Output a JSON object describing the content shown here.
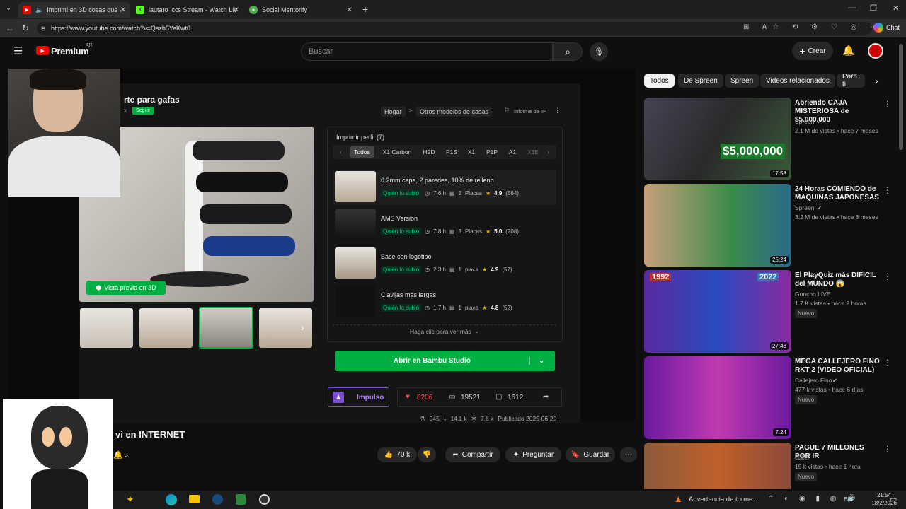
{
  "tabs": [
    {
      "label": "Imprimí en 3D cosas que vi en",
      "active": true
    },
    {
      "label": "lautaro_ccs Stream - Watch Live o"
    },
    {
      "label": "Social Mentorify"
    }
  ],
  "address": {
    "url": "https://www.youtube.com/watch?v=Qszb5YeKwt0",
    "chat_label": "Chat"
  },
  "youtube": {
    "brand": "Premium",
    "region": "AR",
    "search_placeholder": "Buscar",
    "create_label": "Crear"
  },
  "model": {
    "title_partial": "rte para gafas",
    "author_partial": "x",
    "follow_label": "Seguir",
    "breadcrumb": [
      "Hogar",
      ">",
      "Otros modelos de casas"
    ],
    "report_label": "Informe de IP",
    "preview3d_label": "Vista previa en 3D",
    "print_profile_header": "Imprimir perfil (7)",
    "printer_tabs": [
      "Todos",
      "X1 Carbon",
      "H2D",
      "P1S",
      "X1",
      "P1P",
      "A1",
      "X1E"
    ],
    "quien_label": "Quién lo subió",
    "profiles": [
      {
        "title": "0.2mm capa, 2 paredes, 10% de relleno",
        "time": "7.6 h",
        "plates": "2",
        "plates_label": "Placas",
        "rating": "4.9",
        "count": "(564)"
      },
      {
        "title": "AMS Version",
        "time": "7.8 h",
        "plates": "3",
        "plates_label": "Placas",
        "rating": "5.0",
        "count": "(208)"
      },
      {
        "title": "Base con logotipo",
        "time": "2.3 h",
        "plates": "1",
        "plates_label": "placa",
        "rating": "4.9",
        "count": "(57)"
      },
      {
        "title": "Clavijas más largas",
        "time": "1.7 h",
        "plates": "1",
        "plates_label": "placa",
        "rating": "4.8",
        "count": "(52)"
      }
    ],
    "more_label": "Haga clic para ver más",
    "open_label": "Abrir en Bambu Studio",
    "boost_label": "Impulso",
    "likes": "8206",
    "collections": "19521",
    "comments_count": "1612",
    "stats": {
      "prints": "945",
      "downloads": "14.1 k",
      "boosts": "7.8 k",
      "published": "Publicado 2025-06-29"
    }
  },
  "video": {
    "title_partial": "vi en INTERNET",
    "like_count": "70 k",
    "share_label": "Compartir",
    "ask_label": "Preguntar",
    "save_label": "Guardar"
  },
  "chips": [
    "Todos",
    "De Spreen",
    "Spreen",
    "Videos relacionados",
    "Para ti"
  ],
  "recommendations": [
    {
      "title": "Abriendo CAJA MISTERIOSA de $5.000.000",
      "channel": "Spreen",
      "meta": "2.1 M de vistas • hace 7 meses",
      "duration": "17:58",
      "thumb_text": "$5,000,000"
    },
    {
      "title": "24 Horas COMIENDO de MAQUINAS JAPONESAS",
      "channel": "Spreen",
      "meta": "3.2 M de vistas • hace 8 meses",
      "duration": "25:24"
    },
    {
      "title": "El PlayQuiz más DIFÍCIL del MUNDO 😱",
      "channel": "Goncho LIVE",
      "meta": "1.7 K vistas • hace 2 horas",
      "badge": "Nuevo",
      "duration": "27:43",
      "thumb_years": [
        "1992",
        "2022"
      ]
    },
    {
      "title": "MEGA CALLEJERO FINO RKT 2 (VIDEO OFICIAL)",
      "channel": "Callejero Fino",
      "meta": "477 k vistas • hace 6 días",
      "badge": "Nuevo",
      "duration": "7:24"
    },
    {
      "title": "PAGUE 7 MILLONES POR IR",
      "channel": "c0ker",
      "meta": "15 k vistas • hace 1 hora",
      "badge": "Nuevo"
    }
  ],
  "taskbar": {
    "weather": "Advertencia de torme...",
    "lang": "ESP",
    "time": "21:54",
    "date": "18/2/2026"
  }
}
